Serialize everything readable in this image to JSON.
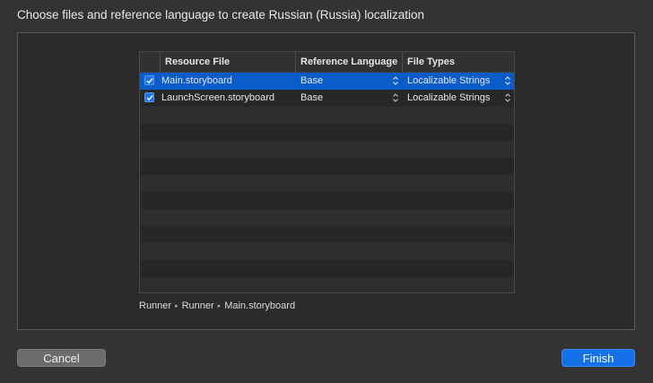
{
  "dialog": {
    "title": "Choose files and reference language to create Russian (Russia) localization"
  },
  "table": {
    "headers": {
      "resource_file": "Resource File",
      "reference_language": "Reference Language",
      "file_types": "File Types"
    },
    "rows": [
      {
        "checked": true,
        "file": "Main.storyboard",
        "language": "Base",
        "type": "Localizable Strings",
        "selected": true
      },
      {
        "checked": true,
        "file": "LaunchScreen.storyboard",
        "language": "Base",
        "type": "Localizable Strings",
        "selected": false
      }
    ]
  },
  "path": {
    "segments": [
      "Runner",
      "Runner",
      "Main.storyboard"
    ],
    "separator": "▸"
  },
  "buttons": {
    "cancel": "Cancel",
    "finish": "Finish"
  },
  "colors": {
    "selection": "#0a5cc8",
    "primary_button": "#1470e6",
    "background": "#333333"
  }
}
